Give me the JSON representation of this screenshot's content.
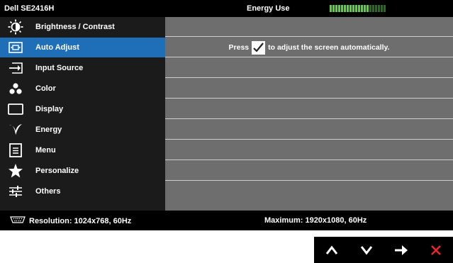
{
  "header": {
    "model": "Dell SE2416H",
    "energy_label": "Energy Use",
    "meter": {
      "total_segments": 20,
      "filled_segments": 14
    }
  },
  "menu": {
    "items": [
      {
        "label": "Brightness / Contrast",
        "icon": "brightness-icon",
        "active": false
      },
      {
        "label": "Auto Adjust",
        "icon": "auto-adjust-icon",
        "active": true
      },
      {
        "label": "Input Source",
        "icon": "input-source-icon",
        "active": false
      },
      {
        "label": "Color",
        "icon": "color-icon",
        "active": false
      },
      {
        "label": "Display",
        "icon": "display-icon",
        "active": false
      },
      {
        "label": "Energy",
        "icon": "energy-icon",
        "active": false
      },
      {
        "label": "Menu",
        "icon": "menu-icon",
        "active": false
      },
      {
        "label": "Personalize",
        "icon": "star-icon",
        "active": false
      },
      {
        "label": "Others",
        "icon": "others-icon",
        "active": false
      }
    ]
  },
  "content": {
    "press_text": "Press",
    "instruction_text": "to adjust the screen automatically."
  },
  "footer": {
    "resolution": "Resolution: 1024x768, 60Hz",
    "maximum": "Maximum: 1920x1080, 60Hz"
  },
  "keys": [
    "up-arrow-icon",
    "down-arrow-icon",
    "right-arrow-icon",
    "close-icon"
  ],
  "colors": {
    "accent": "#1f6eb8",
    "meter_on": "#5fd13a",
    "meter_off": "#2a6b1e",
    "close": "#e8262b",
    "content_bg": "#6e6e6e"
  }
}
